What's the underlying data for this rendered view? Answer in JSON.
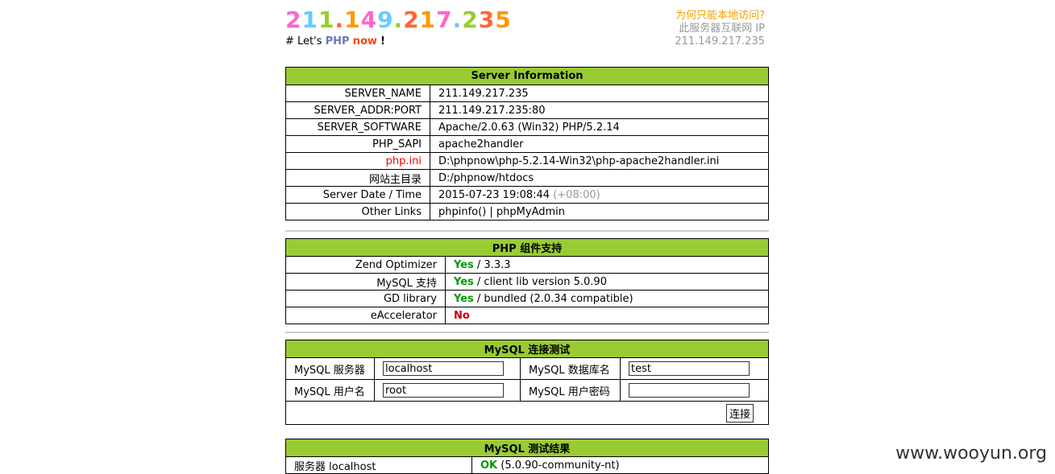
{
  "header": {
    "big_ip": "211.149.217.235",
    "tag_hash": "# Let's",
    "tag_php": "PHP",
    "tag_now": "now",
    "tag_bang": "!",
    "side_q": "为何只能本地访问?",
    "side_l2": "此服务器互联网 IP",
    "side_l3": "211.149.217.235"
  },
  "server_info": {
    "title": "Server Information",
    "rows": [
      {
        "key": "SERVER_NAME",
        "value": "211.149.217.235"
      },
      {
        "key": "SERVER_ADDR:PORT",
        "value": "211.149.217.235:80"
      },
      {
        "key": "SERVER_SOFTWARE",
        "value": "Apache/2.0.63 (Win32) PHP/5.2.14"
      },
      {
        "key": "PHP_SAPI",
        "value": "apache2handler"
      },
      {
        "key": "php.ini",
        "value": "D:\\phpnow\\php-5.2.14-Win32\\php-apache2handler.ini"
      },
      {
        "key": "网站主目录",
        "value": "D:/phpnow/htdocs"
      },
      {
        "key": "Server Date / Time",
        "value": "2015-07-23 19:08:44",
        "extra": "(+08:00)"
      },
      {
        "key": "Other Links",
        "value": "phpinfo() | phpMyAdmin"
      }
    ]
  },
  "php_components": {
    "title": "PHP 组件支持",
    "rows": [
      {
        "key": "Zend Optimizer",
        "status": "Yes",
        "detail": "/ 3.3.3"
      },
      {
        "key": "MySQL 支持",
        "status": "Yes",
        "detail": "/ client lib version 5.0.90"
      },
      {
        "key": "GD library",
        "status": "Yes",
        "detail": "/ bundled (2.0.34 compatible)"
      },
      {
        "key": "eAccelerator",
        "status": "No",
        "detail": ""
      }
    ]
  },
  "mysql_test": {
    "title": "MySQL 连接测试",
    "server_label": "MySQL 服务器",
    "server_value": "localhost",
    "db_label": "MySQL 数据库名",
    "db_value": "test",
    "user_label": "MySQL 用户名",
    "user_value": "root",
    "pass_label": "MySQL 用户密码",
    "pass_value": "",
    "connect_label": "连接"
  },
  "mysql_result": {
    "title": "MySQL 测试结果",
    "server_text": "服务器 localhost",
    "ok": "OK",
    "version": "(5.0.90-community-nt)"
  },
  "watermark": "www.wooyun.org",
  "colors": {
    "header_bg": "#99cc33",
    "yes": "#009900",
    "no": "#cc0000",
    "ip_palette": [
      "#ff66cc",
      "#66ccff",
      "#99cc33",
      "#ff6633",
      "#ff9900"
    ]
  }
}
